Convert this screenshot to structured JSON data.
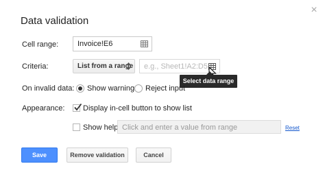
{
  "dialog": {
    "title": "Data validation",
    "close_icon": "close-icon"
  },
  "cell_range": {
    "label": "Cell range:",
    "value": "Invoice!E6",
    "icon": "grid-icon"
  },
  "criteria": {
    "label": "Criteria:",
    "selected": "List from a range",
    "placeholder": "e.g., Sheet1!A2:D5",
    "icon": "grid-icon",
    "tooltip": "Select data range"
  },
  "on_invalid": {
    "label": "On invalid data:",
    "options": [
      {
        "label": "Show warning",
        "selected": true
      },
      {
        "label": "Reject input",
        "selected": false
      }
    ]
  },
  "appearance": {
    "label": "Appearance:",
    "show_list_label": "Display in-cell button to show list",
    "show_list_checked": true,
    "show_help_label": "Show help:",
    "show_help_checked": false,
    "help_placeholder": "Click and enter a value from range",
    "reset_label": "Reset"
  },
  "buttons": {
    "save": "Save",
    "remove": "Remove validation",
    "cancel": "Cancel"
  },
  "colors": {
    "primary": "#4d90fe",
    "link": "#1155cc",
    "tooltip_bg": "#2a2a2a"
  }
}
